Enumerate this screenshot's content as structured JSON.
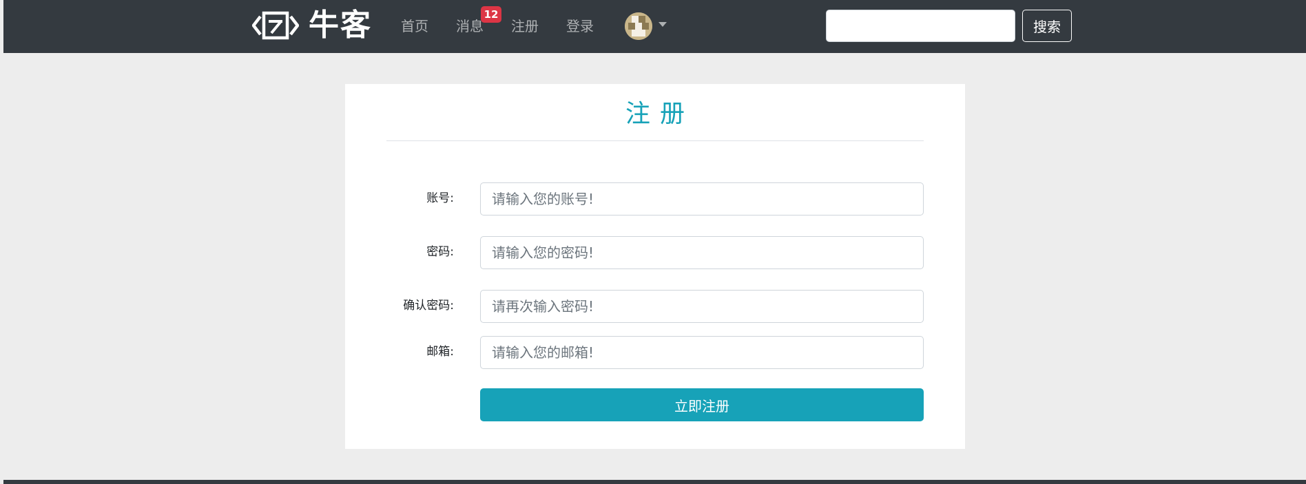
{
  "nav": {
    "logo_text": "牛客",
    "logo_icon": "niuke-logo-icon",
    "links": [
      "首页",
      "消息",
      "注册",
      "登录"
    ],
    "message_badge": "12",
    "search_placeholder": "",
    "search_label": "搜索"
  },
  "form": {
    "title": "注册",
    "fields": [
      {
        "label": "账号:",
        "placeholder": "请输入您的账号!"
      },
      {
        "label": "密码:",
        "placeholder": "请输入您的密码!"
      },
      {
        "label": "确认密码:",
        "placeholder": "请再次输入密码!"
      },
      {
        "label": "邮箱:",
        "placeholder": "请输入您的邮箱!"
      }
    ],
    "submit_label": "立即注册"
  },
  "colors": {
    "navbar": "#343a40",
    "accent": "#17a2b8",
    "badge": "#dc3545",
    "background": "#ededed"
  }
}
